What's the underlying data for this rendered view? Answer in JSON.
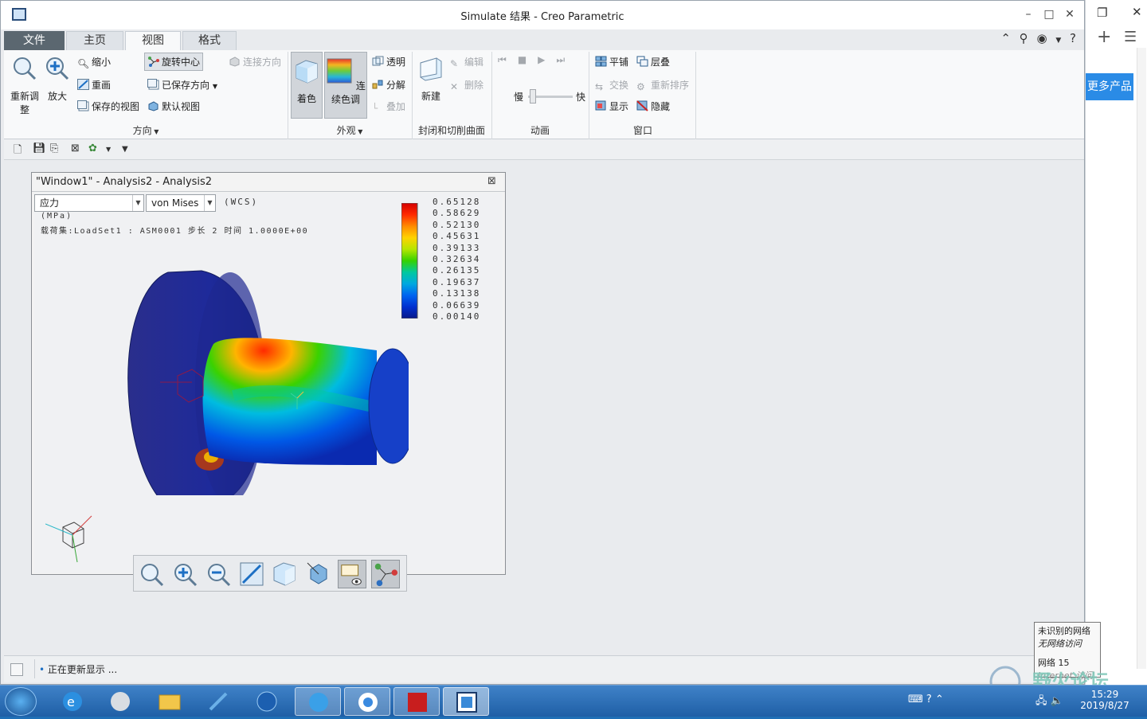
{
  "window": {
    "title": "Simulate 结果 - Creo Parametric"
  },
  "tabs": [
    {
      "label": "文件"
    },
    {
      "label": "主页"
    },
    {
      "label": "视图"
    },
    {
      "label": "格式"
    }
  ],
  "ribbon": {
    "orientation": {
      "group_label": "方向",
      "refit_label": "重新调整",
      "zoom_in_label": "放大",
      "zoom_out_label": "缩小",
      "repaint_label": "重画",
      "saved_views_label": "保存的视图",
      "spin_center_label": "旋转中心",
      "saved_orientations_label": "已保存方向",
      "default_view_label": "默认视图",
      "connect_orient_label": "连接方向"
    },
    "appearance": {
      "group_label": "外观",
      "shade_label": "着色",
      "continuous_tone_label": "连续色调",
      "transparent_label": "透明",
      "explode_label": "分解",
      "overlay_label": "叠加"
    },
    "capping": {
      "group_label": "封闭和切削曲面",
      "new_label": "新建",
      "edit_label": "编辑",
      "delete_label": "删除"
    },
    "animation": {
      "group_label": "动画",
      "slow_label": "慢",
      "fast_label": "快"
    },
    "window": {
      "group_label": "窗口",
      "tile_label": "平铺",
      "cascade_label": "层叠",
      "swap_label": "交换",
      "reorder_label": "重新排序",
      "show_label": "显示",
      "hide_label": "隐藏"
    }
  },
  "analysis_window": {
    "title": "\"Window1\" - Analysis2 - Analysis2",
    "quantity_select": "应力",
    "component_select": "von Mises",
    "coord_label": "(WCS)",
    "unit_label": "(MPa)",
    "loadset_line": "载荷集:LoadSet1 :  ASM0001  步长 2 时间  1.0000E+00",
    "legend_values": [
      "0.65128",
      "0.58629",
      "0.52130",
      "0.45631",
      "0.39133",
      "0.32634",
      "0.26135",
      "0.19637",
      "0.13138",
      "0.06639",
      "0.00140"
    ]
  },
  "status": {
    "message": "正在更新显示 ..."
  },
  "right_panel": {
    "more_products_label": "更多产品"
  },
  "tooltip": {
    "line1": "未识别的网络",
    "line2": "无网络访问",
    "line3": "网络  15",
    "line4": "Internet 访问"
  },
  "taskbar": {
    "time": "15:29",
    "date": "2019/8/27"
  },
  "watermark": {
    "text": "野火论坛"
  }
}
